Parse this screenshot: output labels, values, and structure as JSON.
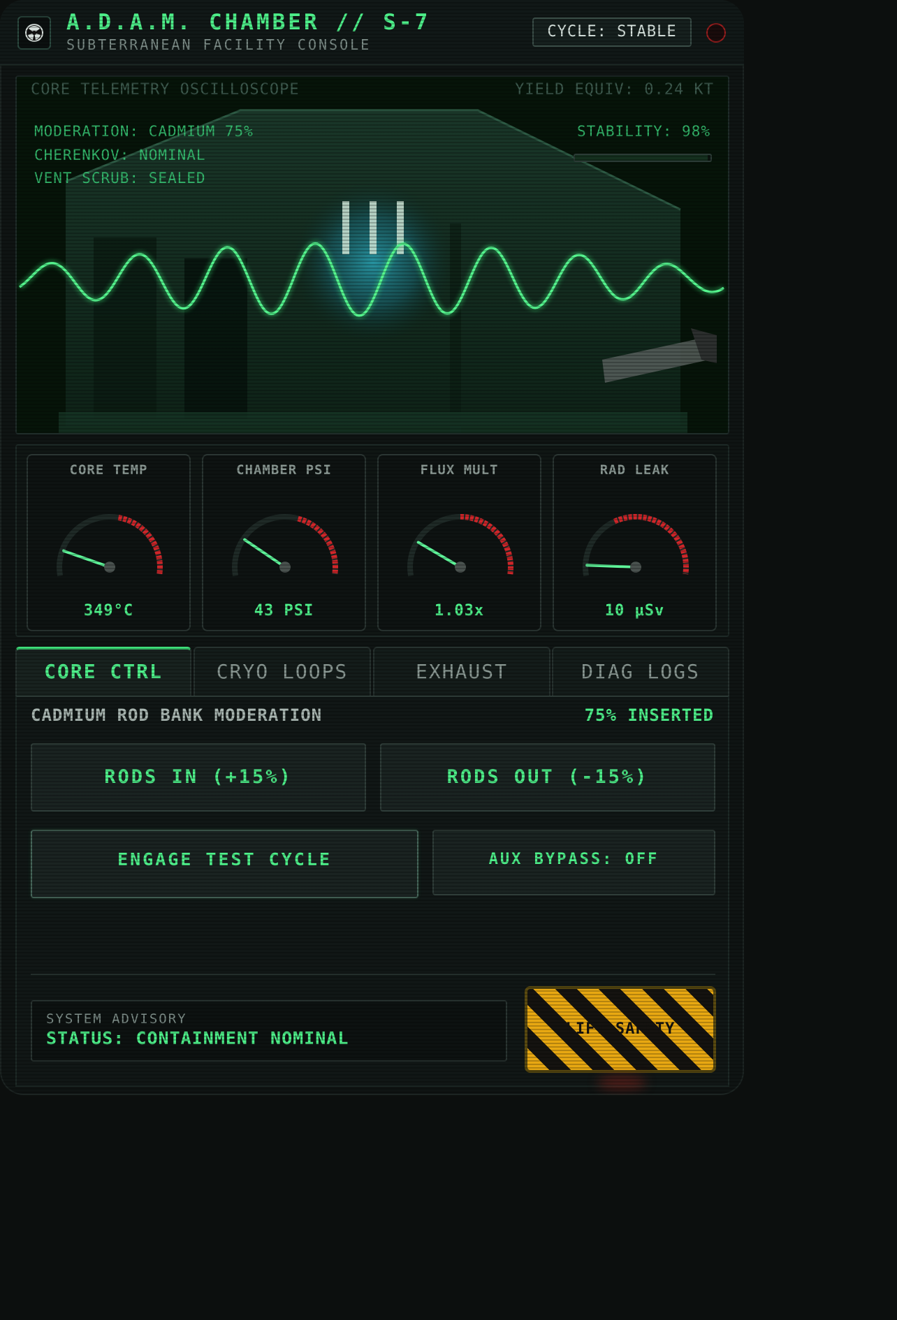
{
  "header": {
    "title": "A.D.A.M. CHAMBER // S-7",
    "subtitle": "SUBTERRANEAN FACILITY CONSOLE",
    "cycle_status": "CYCLE: STABLE",
    "logo_icon": "radiation-icon",
    "power_icon": "power-indicator-icon"
  },
  "scope": {
    "title": "CORE TELEMETRY OSCILLOSCOPE",
    "yield": "YIELD EQUIV: 0.24 KT",
    "readouts": [
      "MODERATION: CADMIUM 75%",
      "CHERENKOV: NOMINAL",
      "VENT SCRUB: SEALED"
    ],
    "stability": "STABILITY: 98%",
    "stability_fraction": 0.98
  },
  "gauges": [
    {
      "title": "CORE TEMP",
      "value": "349°C",
      "needle_fraction": 0.24
    },
    {
      "title": "CHAMBER PSI",
      "value": "43 PSI",
      "needle_fraction": 0.36
    },
    {
      "title": "FLUX MULT",
      "value": "1.03x",
      "needle_fraction": 0.33
    },
    {
      "title": "RAD LEAK",
      "value": "10 µSv",
      "needle_fraction": 0.1
    }
  ],
  "tabs": [
    {
      "label": "CORE CTRL",
      "active": true
    },
    {
      "label": "CRYO LOOPS",
      "active": false
    },
    {
      "label": "EXHAUST",
      "active": false
    },
    {
      "label": "DIAG LOGS",
      "active": false
    }
  ],
  "panel": {
    "title": "CADMIUM ROD BANK MODERATION",
    "value": "75% INSERTED",
    "rods_in": "RODS IN (+15%)",
    "rods_out": "RODS OUT (-15%)",
    "engage": "ENGAGE TEST CYCLE",
    "aux": "AUX BYPASS: OFF"
  },
  "advisory": {
    "label": "SYSTEM ADVISORY",
    "status": "STATUS: CONTAINMENT NOMINAL"
  },
  "safety": {
    "label": "LIFT SAFETY"
  },
  "colors": {
    "accent": "#4ef08a",
    "danger": "#d0262a",
    "hazard": "#e8a812"
  }
}
